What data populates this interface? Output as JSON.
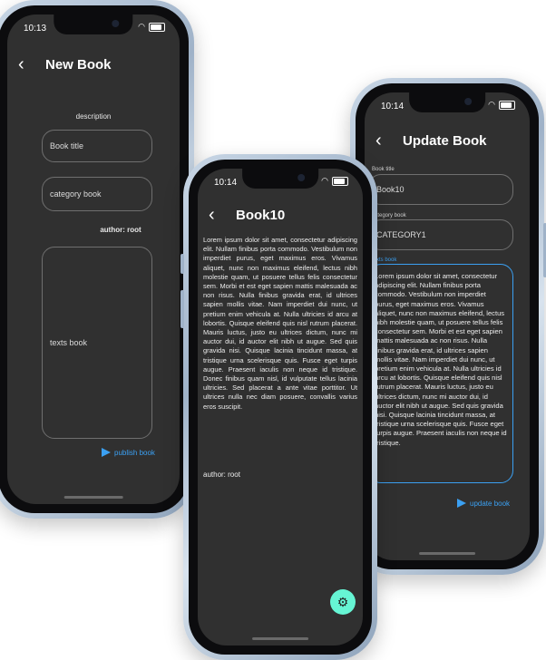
{
  "phone_left": {
    "time": "10:13",
    "title": "New Book",
    "description_label": "description",
    "book_title_placeholder": "Book title",
    "category_placeholder": "category book",
    "author_label": "author: root",
    "texts_placeholder": "texts book",
    "publish_label": "publish book"
  },
  "phone_middle": {
    "time": "10:14",
    "title": "Book10",
    "body": "Lorem ipsum dolor sit amet, consectetur adipiscing elit. Nullam finibus porta commodo. Vestibulum non imperdiet purus, eget maximus eros. Vivamus aliquet, nunc non maximus eleifend, lectus nibh molestie quam, ut posuere tellus felis consectetur sem. Morbi et est eget sapien mattis malesuada ac non risus. Nulla finibus gravida erat, id ultrices sapien mollis vitae. Nam imperdiet dui nunc, ut pretium enim vehicula at. Nulla ultricies id arcu at lobortis. Quisque eleifend quis nisl rutrum placerat. Mauris luctus, justo eu ultrices dictum, nunc mi auctor dui, id auctor elit nibh ut augue. Sed quis gravida nisi. Quisque lacinia tincidunt massa, at tristique urna scelerisque quis. Fusce eget turpis augue. Praesent iaculis non neque id tristique. Donec finibus quam nisl, id vulputate tellus lacinia ultricies. Sed placerat a ante vitae porttitor. Ut ultrices nulla nec diam posuere, convallis varius eros suscipit.",
    "author": "author: root"
  },
  "phone_right": {
    "time": "10:14",
    "title": "Update Book",
    "book_title_label": "Book title",
    "book_title_value": "Book10",
    "category_label": "category book",
    "category_value": "CATEGORY1",
    "texts_label": "texts book",
    "texts_value": "Lorem ipsum dolor sit amet, consectetur adipiscing elit. Nullam finibus porta commodo. Vestibulum non imperdiet purus, eget maximus eros. Vivamus aliquet, nunc non maximus eleifend, lectus nibh molestie quam, ut posuere tellus felis consectetur sem. Morbi et est eget sapien mattis malesuada ac non risus. Nulla finibus gravida erat, id ultrices sapien mollis vitae. Nam imperdiet dui nunc, ut pretium enim vehicula at. Nulla ultricies id arcu at lobortis. Quisque eleifend quis nisl rutrum placerat. Mauris luctus, justo eu ultrices dictum, nunc mi auctor dui, id auctor elit nibh ut augue. Sed quis gravida nisi. Quisque lacinia tincidunt massa, at tristique urna scelerisque quis. Fusce eget turpis augue. Praesent iaculis non neque id tristique.",
    "update_label": "update book"
  },
  "colors": {
    "screen_bg": "#303030",
    "accent_blue": "#3ba0f2",
    "fab_teal": "#66f5d4"
  }
}
